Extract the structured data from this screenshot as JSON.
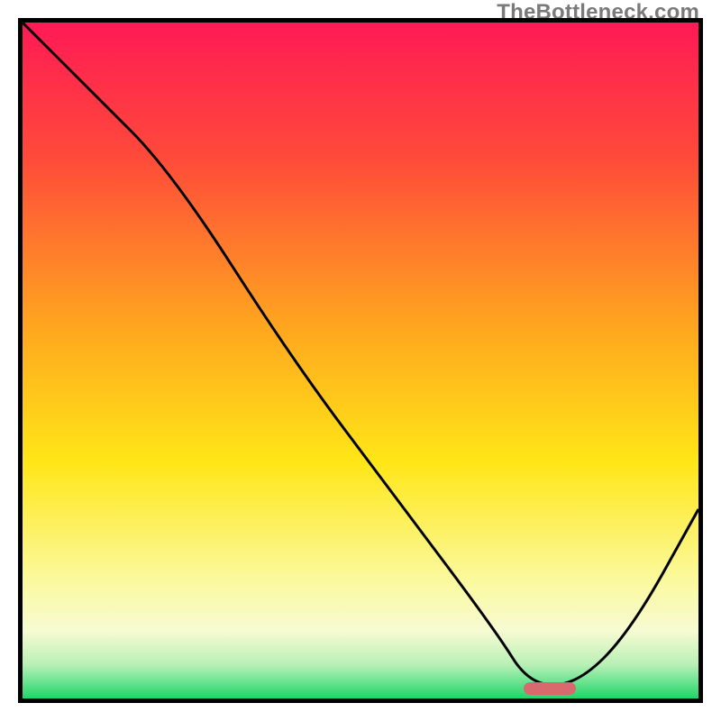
{
  "watermark": "TheBottleneck.com",
  "gradient": {
    "stops": [
      {
        "pct": 0,
        "color": "#ff1a55"
      },
      {
        "pct": 20,
        "color": "#ff4a3a"
      },
      {
        "pct": 45,
        "color": "#ffa61f"
      },
      {
        "pct": 65,
        "color": "#ffe617"
      },
      {
        "pct": 82,
        "color": "#fbf99a"
      },
      {
        "pct": 90,
        "color": "#f7fbd2"
      },
      {
        "pct": 95,
        "color": "#b9f0b6"
      },
      {
        "pct": 100,
        "color": "#1fd66a"
      }
    ]
  },
  "marker": {
    "x_pct": 78,
    "y_pct": 98.5,
    "color": "#d86a6f"
  },
  "chart_data": {
    "type": "line",
    "title": "",
    "xlabel": "",
    "ylabel": "",
    "xlim": [
      0,
      100
    ],
    "ylim": [
      0,
      100
    ],
    "annotations": [
      "TheBottleneck.com"
    ],
    "series": [
      {
        "name": "bottleneck-curve",
        "x": [
          0,
          10,
          22,
          40,
          55,
          70,
          75,
          82,
          90,
          100
        ],
        "y": [
          100,
          90,
          78,
          50,
          30,
          10,
          2,
          2,
          10,
          28
        ]
      }
    ],
    "optimal_point": {
      "x": 78,
      "y": 1.5
    }
  }
}
